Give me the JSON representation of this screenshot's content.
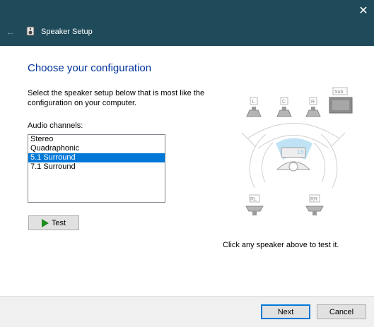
{
  "window": {
    "title": "Speaker Setup",
    "close_glyph": "✕",
    "back_glyph": "←"
  },
  "main": {
    "heading": "Choose your configuration",
    "description": "Select the speaker setup below that is most like the configuration on your computer.",
    "channels_label": "Audio channels:",
    "channels": [
      {
        "label": "Stereo",
        "selected": false
      },
      {
        "label": "Quadraphonic",
        "selected": false
      },
      {
        "label": "5.1 Surround",
        "selected": true
      },
      {
        "label": "7.1 Surround",
        "selected": false
      }
    ],
    "test_label": "Test",
    "hint": "Click any speaker above to test it."
  },
  "speakers": {
    "front_left": "L",
    "center": "C",
    "front_right": "R",
    "subwoofer": "Sub",
    "rear_left": "RL",
    "rear_right": "RR"
  },
  "footer": {
    "next_label": "Next",
    "cancel_label": "Cancel"
  },
  "colors": {
    "titlebar": "#1f4a5a",
    "heading": "#003399",
    "selection": "#0078d7",
    "play": "#1e8c1e"
  }
}
